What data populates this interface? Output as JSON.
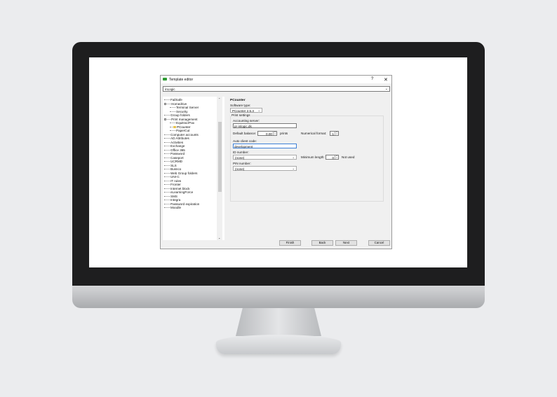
{
  "dialog": {
    "title": "Template editor",
    "help": "?",
    "close": "✕",
    "template_combo": "inLogic"
  },
  "tree": {
    "items": [
      {
        "label": "FailSafe"
      },
      {
        "label": "Homedrive"
      },
      {
        "label": "Terminal Server"
      },
      {
        "label": "Security"
      },
      {
        "label": "Group folders"
      },
      {
        "label": "Print management"
      },
      {
        "label": "Equitrac/Pax"
      },
      {
        "label": "PCounter"
      },
      {
        "label": "PaperCut"
      },
      {
        "label": "Computer accounts"
      },
      {
        "label": "AD Attributes"
      },
      {
        "label": "Activities"
      },
      {
        "label": "Exchange"
      },
      {
        "label": "Office 365"
      },
      {
        "label": "Password"
      },
      {
        "label": "Caseport"
      },
      {
        "label": "UCRMD"
      },
      {
        "label": "SLS"
      },
      {
        "label": "Busnco"
      },
      {
        "label": "Web Group folders"
      },
      {
        "label": "UNI-C"
      },
      {
        "label": "IT rules"
      },
      {
        "label": "Fronter"
      },
      {
        "label": "Internet block"
      },
      {
        "label": "eLearningForce"
      },
      {
        "label": "SMS"
      },
      {
        "label": "Integra"
      },
      {
        "label": "Password expiration"
      },
      {
        "label": "Moodle"
      }
    ]
  },
  "pane": {
    "title": "PCounter",
    "software_type_label": "Software type:",
    "software_type_value": "PCounter 2.5.3",
    "print_settings_label": "Print settings",
    "accounting_server_label": "Accounting server:",
    "accounting_server_value": "pr-inlogic.dk",
    "default_balance_label": "Default balance:",
    "default_balance_value": "0.00",
    "prints_label": "prints",
    "numerical_format_label": "Numerical format:",
    "numerical_format_value": "1",
    "auto_client_code_label": "Auto client code:",
    "auto_client_code_value": "development",
    "id_number_label": "ID number:",
    "id_number_value": "(none)",
    "minimum_length_label": "Minimum length:",
    "minimum_length_value": "0",
    "not_used_label": "Not used",
    "pin_number_label": "PIN number:",
    "pin_number_value": "(none)"
  },
  "buttons": {
    "finish": "Finish",
    "back": "Back",
    "next": "Next",
    "cancel": "Cancel"
  }
}
